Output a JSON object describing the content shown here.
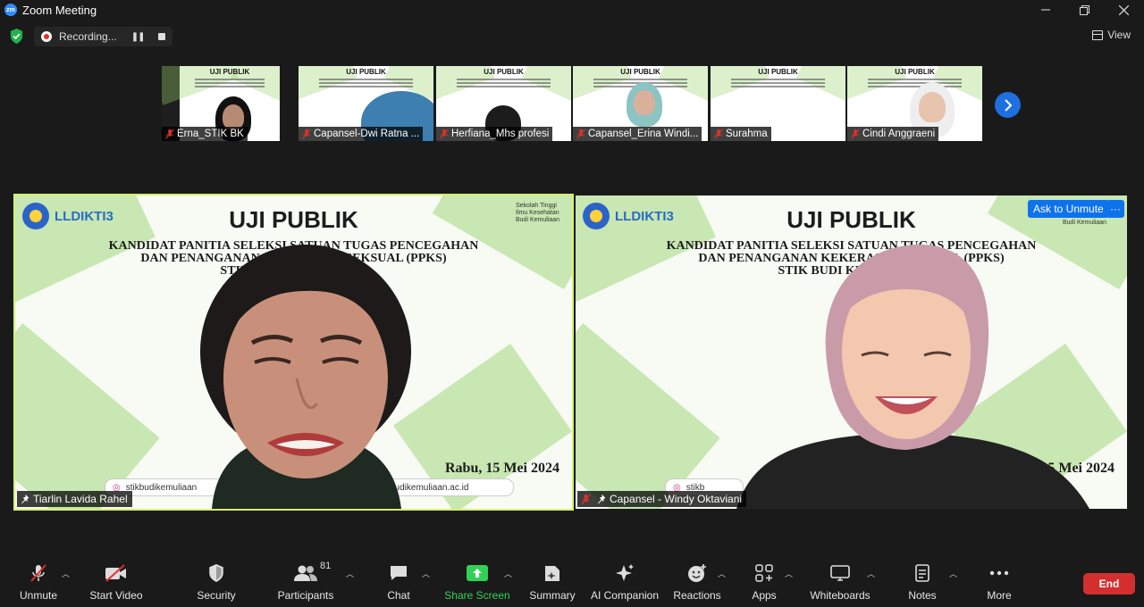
{
  "window": {
    "title": "Zoom Meeting",
    "logo_text": "zm"
  },
  "recording": {
    "label": "Recording...",
    "pause_icon": "pause-icon",
    "stop_icon": "stop-icon"
  },
  "view_button": {
    "label": "View"
  },
  "slide": {
    "title": "UJI PUBLIK",
    "subtitle_lines": [
      "KANDIDAT PANITIA SELEKSI SATUAN TUGAS PENCEGAHAN",
      "DAN PENANGANAN KEKERASAN SEKSUAL (PPKS)",
      "STIK BUDI KEMULIAAN"
    ],
    "date": "Rabu, 15 Mei 2024",
    "left_logo": "LLDIKTI3",
    "right_logo_lines": [
      "Sekolah Tinggi",
      "Ilmu Kesehatan",
      "Budi Kemuliaan"
    ],
    "social_handle": "stikbudikemuliaan",
    "website": "budikemuliaan.ac.id"
  },
  "thumbnails": [
    {
      "name": "Erna_STIK BK",
      "muted": true
    },
    {
      "name": "Capansel-Dwi Ratna ...",
      "muted": true
    },
    {
      "name": "Herfiana_Mhs profesi",
      "muted": true
    },
    {
      "name": "Capansel_Erina Windi...",
      "muted": true
    },
    {
      "name": "Surahma",
      "muted": true
    },
    {
      "name": "Cindi Anggraeni",
      "muted": true
    }
  ],
  "main_tiles": [
    {
      "name": "Tiarlin Lavida Rahel",
      "speaking": true,
      "social_text": "stikbudikemuliaan",
      "web_text": "budikemuliaan.ac.id"
    },
    {
      "name": "Capansel - Windy Oktaviani",
      "speaking": false,
      "muted": true,
      "social_text": "stikb",
      "right_logo_text": "Budi Kemuliaan"
    }
  ],
  "ask_to_unmute": {
    "label": "Ask to Unmute",
    "more_label": "···"
  },
  "toolbar": {
    "unmute": "Unmute",
    "start_video": "Start Video",
    "security": "Security",
    "participants": "Participants",
    "participants_count": "81",
    "chat": "Chat",
    "share_screen": "Share Screen",
    "summary": "Summary",
    "ai_companion": "AI Companion",
    "reactions": "Reactions",
    "apps": "Apps",
    "whiteboards": "Whiteboards",
    "notes": "Notes",
    "more": "More",
    "end": "End"
  },
  "colors": {
    "accent_blue": "#0e72ed",
    "active_speaker": "#d4f26b",
    "share_green": "#31d158",
    "end_red": "#d32f2f",
    "slide_green": "#8fce62"
  }
}
